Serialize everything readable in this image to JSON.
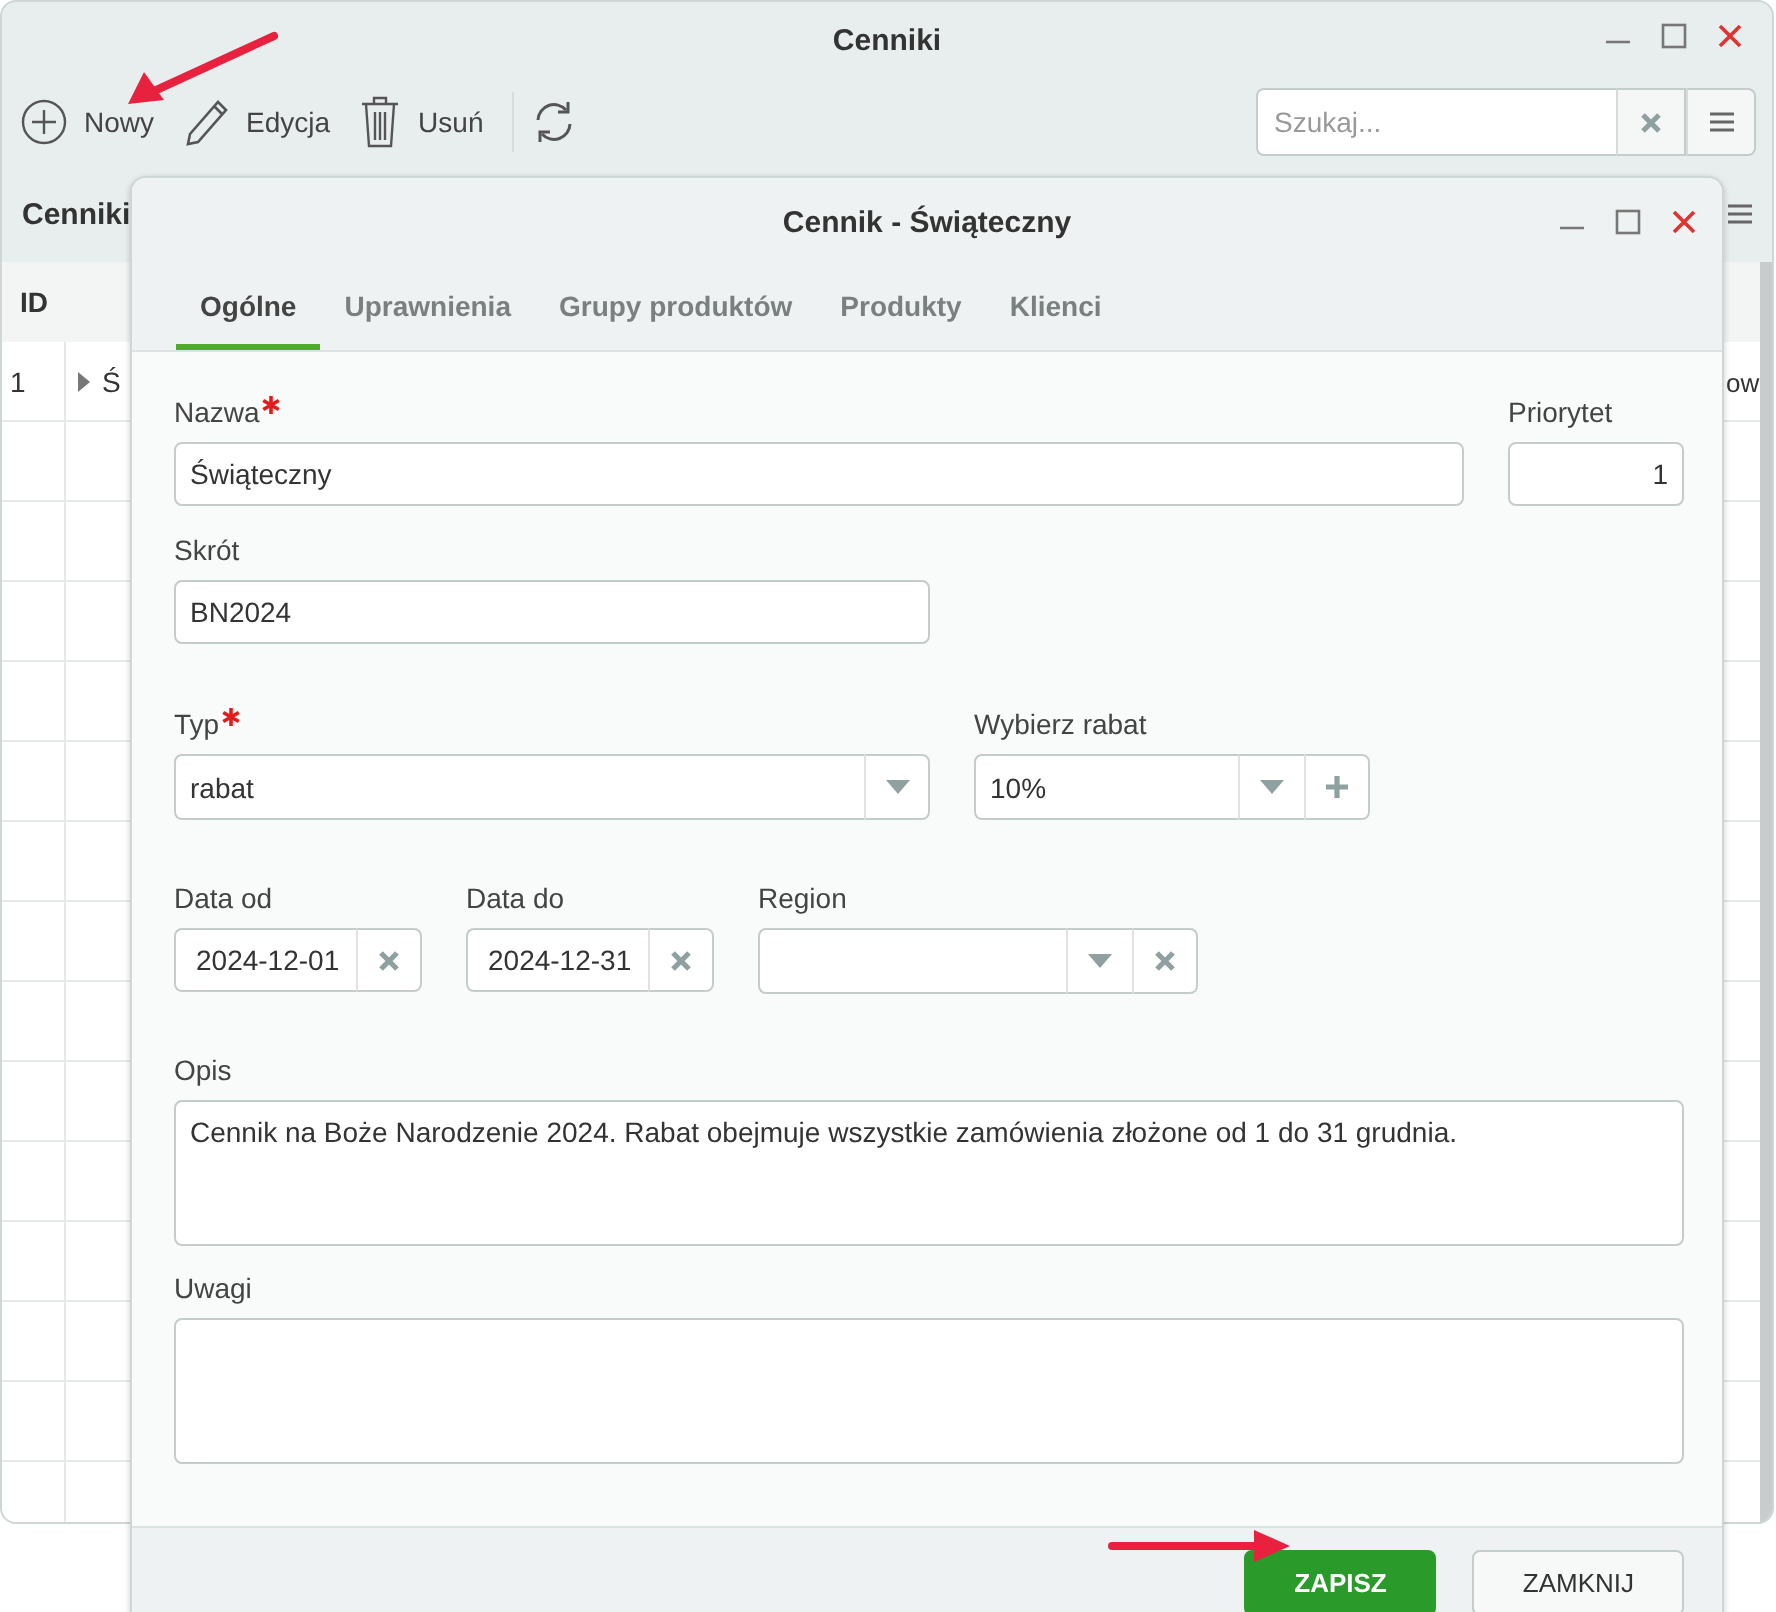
{
  "window": {
    "title": "Cenniki"
  },
  "toolbar": {
    "buttons": [
      {
        "kind": "new",
        "label": "Nowy"
      },
      {
        "kind": "edit",
        "label": "Edycja"
      },
      {
        "kind": "delete",
        "label": "Usuń"
      },
      {
        "kind": "refresh"
      }
    ],
    "search": {
      "placeholder": "Szukaj..."
    }
  },
  "panel": {
    "title": "Cenniki"
  },
  "grid": {
    "columns": [
      "ID"
    ],
    "rows": [
      {
        "id": "1",
        "name": "Ś",
        "column_4": "ow"
      }
    ]
  },
  "dialog": {
    "title": "Cennik - Świąteczny",
    "tabs": [
      {
        "label": "Ogólne",
        "selected": true
      },
      {
        "label": "Uprawnienia",
        "selected": false
      },
      {
        "label": "Grupy produktów",
        "selected": false
      },
      {
        "label": "Produkty",
        "selected": false
      },
      {
        "label": "Klienci",
        "selected": false
      }
    ],
    "rows": [
      [
        {
          "kind": "text",
          "label": "Nazwa",
          "required": true,
          "value": "Świąteczny"
        },
        {
          "kind": "number",
          "label": "Priorytet",
          "required": false,
          "value": "1"
        }
      ],
      [
        {
          "kind": "text",
          "label": "Skrót",
          "required": false,
          "value": "BN2024"
        }
      ],
      [
        {
          "kind": "select",
          "label": "Typ",
          "required": true,
          "value": "rabat"
        },
        {
          "kind": "select-add",
          "label": "Wybierz rabat",
          "required": false,
          "value": "10%"
        }
      ],
      [
        {
          "kind": "date",
          "label": "Data od",
          "required": false,
          "value": "2024-12-01"
        },
        {
          "kind": "date",
          "label": "Data do",
          "required": false,
          "value": "2024-12-31"
        },
        {
          "kind": "select-clear",
          "label": "Region",
          "required": false
        }
      ],
      [
        {
          "kind": "textarea",
          "label": "Opis",
          "required": false,
          "value": "Cennik na Boże Narodzenie 2024. Rabat obejmuje wszystkie zamówienia złożone od 1 do 31 grudnia."
        }
      ],
      [
        {
          "kind": "textarea",
          "label": "Uwagi",
          "required": false
        }
      ]
    ],
    "buttons": [
      {
        "label": "ZAPISZ",
        "primary": true
      },
      {
        "label": "ZAMKNIJ",
        "primary": false
      }
    ]
  }
}
